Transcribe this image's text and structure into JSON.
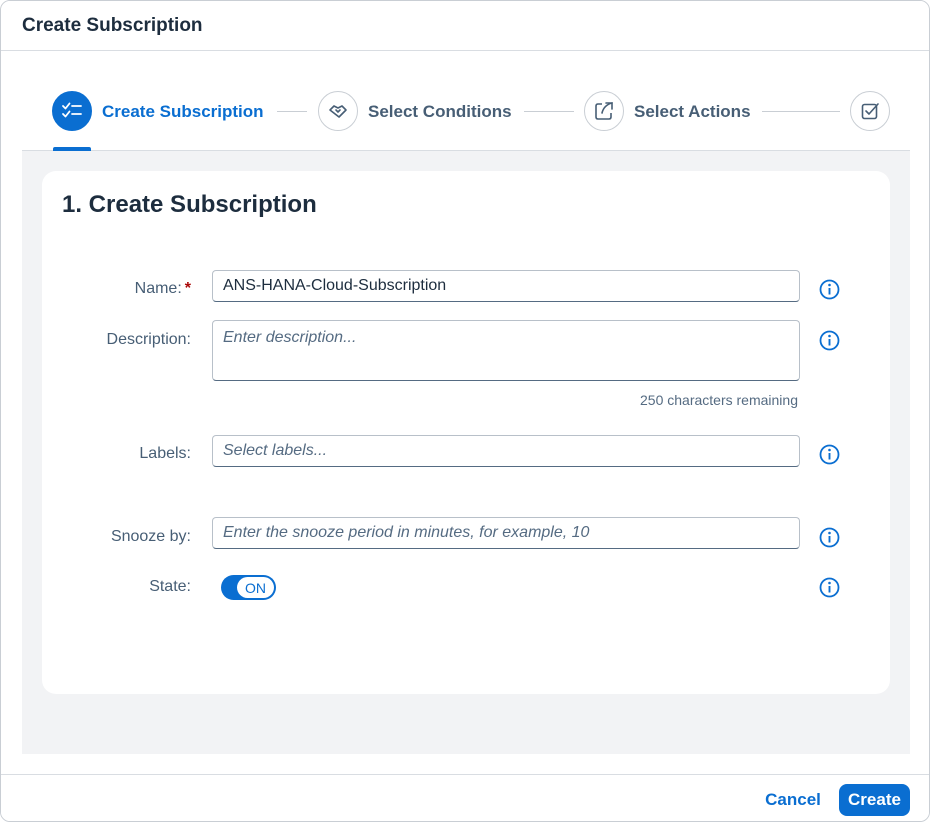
{
  "dialog": {
    "title": "Create Subscription"
  },
  "wizard": {
    "steps": [
      {
        "label": "Create Subscription",
        "icon": "checklist-icon",
        "active": true
      },
      {
        "label": "Select Conditions",
        "icon": "handshake-icon",
        "active": false
      },
      {
        "label": "Select Actions",
        "icon": "share-icon",
        "active": false
      },
      {
        "label": "",
        "icon": "checkbox-icon",
        "active": false
      }
    ]
  },
  "form": {
    "section_title": "1. Create Subscription",
    "name": {
      "label": "Name:",
      "required_marker": "*",
      "value": "ANS-HANA-Cloud-Subscription"
    },
    "description": {
      "label": "Description:",
      "placeholder": "Enter description...",
      "counter": "250 characters remaining"
    },
    "labels": {
      "label": "Labels:",
      "placeholder": "Select labels..."
    },
    "snooze": {
      "label": "Snooze by:",
      "placeholder": "Enter the snooze period in minutes, for example, 10"
    },
    "state": {
      "label": "State:",
      "toggle_text": "ON"
    }
  },
  "footer": {
    "cancel_label": "Cancel",
    "create_label": "Create"
  },
  "colors": {
    "accent": "#0a6ed1",
    "required": "#aa0808",
    "background": "#f2f3f5"
  }
}
